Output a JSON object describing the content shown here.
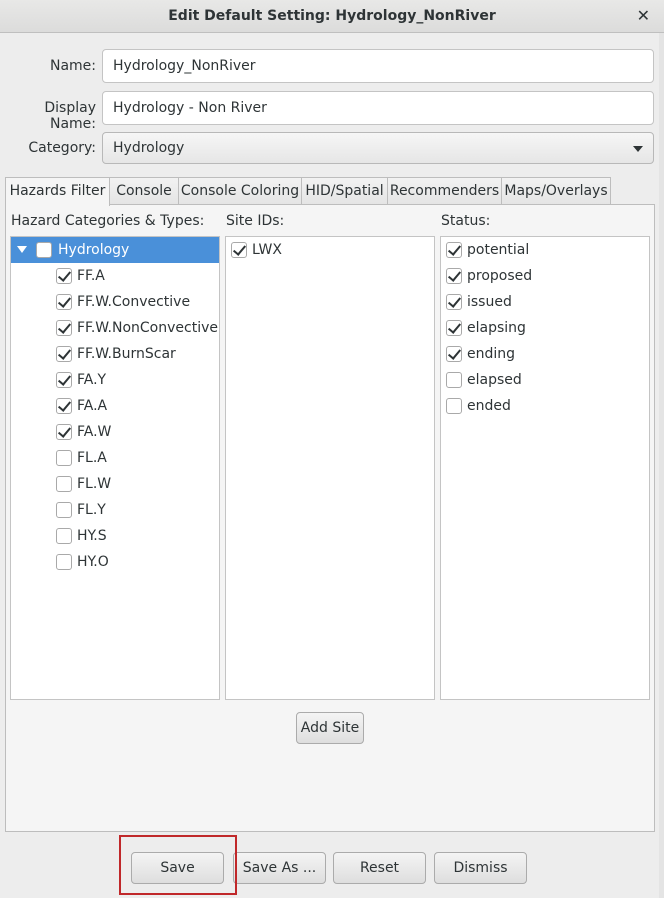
{
  "window": {
    "title": "Edit Default Setting: Hydrology_NonRiver",
    "close_glyph": "✕"
  },
  "form": {
    "name_label": "Name:",
    "name_value": "Hydrology_NonRiver",
    "display_name_label": "Display Name:",
    "display_name_value": "Hydrology - Non River",
    "category_label": "Category:",
    "category_value": "Hydrology"
  },
  "tabs": [
    "Hazards Filter",
    "Console",
    "Console Coloring",
    "HID/Spatial",
    "Recommenders",
    "Maps/Overlays"
  ],
  "active_tab": "Hazards Filter",
  "hazards": {
    "label": "Hazard Categories & Types:",
    "group": {
      "label": "Hydrology",
      "checked": false,
      "expanded": true
    },
    "items": [
      {
        "label": "FF.A",
        "checked": true
      },
      {
        "label": "FF.W.Convective",
        "checked": true
      },
      {
        "label": "FF.W.NonConvective",
        "checked": true
      },
      {
        "label": "FF.W.BurnScar",
        "checked": true
      },
      {
        "label": "FA.Y",
        "checked": true
      },
      {
        "label": "FA.A",
        "checked": true
      },
      {
        "label": "FA.W",
        "checked": true
      },
      {
        "label": "FL.A",
        "checked": false
      },
      {
        "label": "FL.W",
        "checked": false
      },
      {
        "label": "FL.Y",
        "checked": false
      },
      {
        "label": "HY.S",
        "checked": false
      },
      {
        "label": "HY.O",
        "checked": false
      }
    ]
  },
  "sites": {
    "label": "Site IDs:",
    "items": [
      {
        "label": "LWX",
        "checked": true
      }
    ],
    "add_button": "Add Site"
  },
  "status": {
    "label": "Status:",
    "items": [
      {
        "label": "potential",
        "checked": true
      },
      {
        "label": "proposed",
        "checked": true
      },
      {
        "label": "issued",
        "checked": true
      },
      {
        "label": "elapsing",
        "checked": true
      },
      {
        "label": "ending",
        "checked": true
      },
      {
        "label": "elapsed",
        "checked": false
      },
      {
        "label": "ended",
        "checked": false
      }
    ]
  },
  "buttons": {
    "save": "Save",
    "save_as": "Save As ...",
    "reset": "Reset",
    "dismiss": "Dismiss"
  },
  "colors": {
    "selection": "#4a90d9",
    "highlight_box": "#c0282a"
  }
}
